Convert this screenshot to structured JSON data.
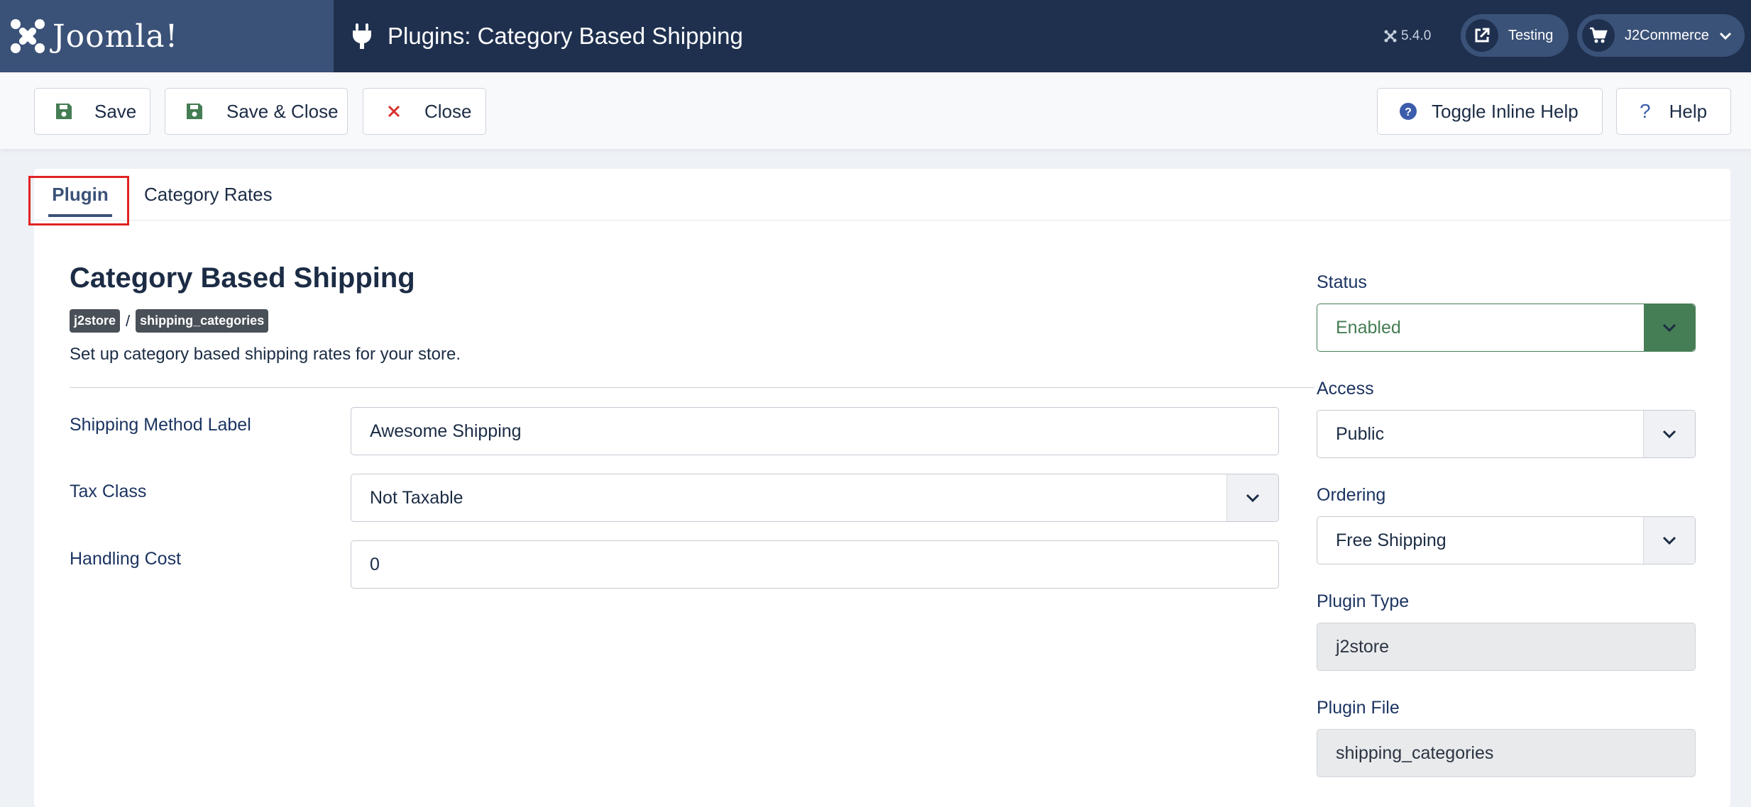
{
  "header": {
    "logo_text": "Joomla!",
    "page_title": "Plugins: Category Based Shipping",
    "version": "5.4.0",
    "site_pill_label": "Testing",
    "user_pill_label": "J2Commerce"
  },
  "toolbar": {
    "save_label": "Save",
    "save_close_label": "Save & Close",
    "close_label": "Close",
    "inline_help_label": "Toggle Inline Help",
    "help_label": "Help"
  },
  "tabs": {
    "plugin": "Plugin",
    "category_rates": "Category Rates"
  },
  "plugin": {
    "title": "Category Based Shipping",
    "group_badge": "j2store",
    "separator": "/",
    "element_badge": "shipping_categories",
    "description": "Set up category based shipping rates for your store."
  },
  "fields": {
    "shipping_label": {
      "label": "Shipping Method Label",
      "value": "Awesome Shipping"
    },
    "tax_class": {
      "label": "Tax Class",
      "value": "Not Taxable"
    },
    "handling_cost": {
      "label": "Handling Cost",
      "value": "0"
    }
  },
  "sidebar": {
    "status": {
      "label": "Status",
      "value": "Enabled"
    },
    "access": {
      "label": "Access",
      "value": "Public"
    },
    "ordering": {
      "label": "Ordering",
      "value": "Free Shipping"
    },
    "plugin_type": {
      "label": "Plugin Type",
      "value": "j2store"
    },
    "plugin_file": {
      "label": "Plugin File",
      "value": "shipping_categories"
    }
  },
  "colors": {
    "header_bg": "#1f304f",
    "logo_bg": "#3b5278",
    "status_green": "#457d54",
    "close_red": "#d9302c",
    "highlight_red": "#e02424"
  },
  "icons": {
    "save": "floppy-disk-icon",
    "close": "x-icon",
    "inline_help": "question-circle-icon",
    "help": "question-icon",
    "plugin": "plug-icon",
    "site": "external-link-icon",
    "user": "cart-icon"
  }
}
